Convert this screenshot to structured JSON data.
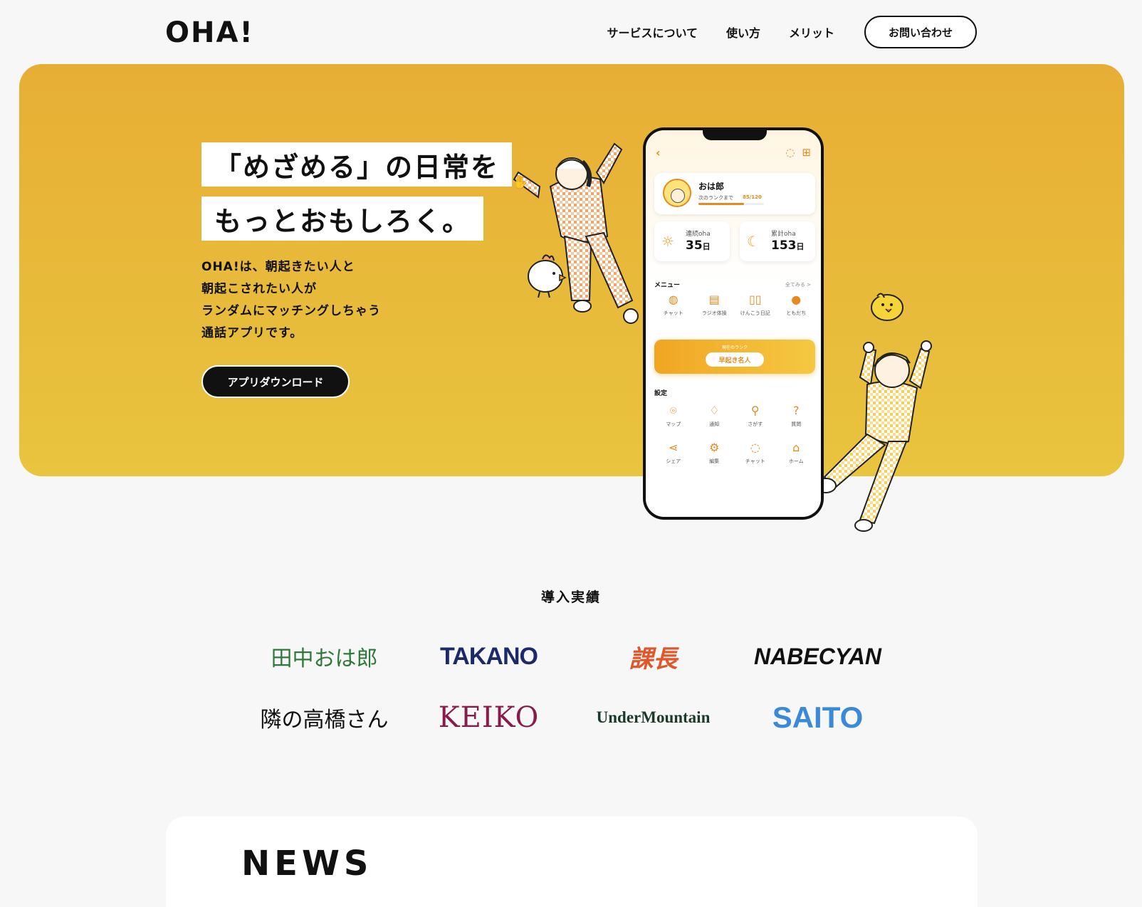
{
  "header": {
    "logo_text": "OHA!",
    "nav": [
      "サービスについて",
      "使い方",
      "メリット"
    ],
    "contact_label": "お問い合わせ"
  },
  "hero": {
    "headline_1": "「めざめる」の日常を",
    "headline_2": "もっとおもしろく。",
    "description": [
      "OHA!は、朝起きたい人と",
      "朝起こされたい人が",
      "ランダムにマッチングしちゃう",
      "通話アプリです。"
    ],
    "download_label": "アプリダウンロード"
  },
  "phone": {
    "back_icon": "chevron-left-icon",
    "profile": {
      "name": "おは郎",
      "rank_text": "次のランクまで",
      "rank_value": "85/120",
      "progress": 0.7
    },
    "stats": [
      {
        "icon": "sunrise-icon",
        "label": "連続oha",
        "value": "35",
        "unit": "日"
      },
      {
        "icon": "moon-icon",
        "label": "累計oha",
        "value": "153",
        "unit": "日"
      }
    ],
    "menu_title": "メニュー",
    "menu_see_all": "全てみる >",
    "menu_items": [
      {
        "icon": "chat-icon",
        "label": "チャット"
      },
      {
        "icon": "radio-icon",
        "label": "ラジオ体操"
      },
      {
        "icon": "book-icon",
        "label": "けんこう日記"
      },
      {
        "icon": "person-icon",
        "label": "ともだち"
      }
    ],
    "rank_caption": "現在のランク",
    "rank_name": "早起き名人",
    "settings_title": "設定",
    "settings_items": [
      {
        "icon": "map-pin-icon",
        "label": "マップ"
      },
      {
        "icon": "bell-icon",
        "label": "通知"
      },
      {
        "icon": "search-icon",
        "label": "さがす"
      },
      {
        "icon": "question-icon",
        "label": "質問"
      },
      {
        "icon": "share-icon",
        "label": "シェア"
      },
      {
        "icon": "gear-icon",
        "label": "編集"
      },
      {
        "icon": "chat-icon",
        "label": "チャット"
      },
      {
        "icon": "home-icon",
        "label": "ホーム"
      }
    ]
  },
  "achievements": {
    "title": "導入実績",
    "logos": [
      {
        "text": "田中おは郎",
        "color": "#2f7a3a"
      },
      {
        "text": "TAKANO",
        "color": "#1c2a6b"
      },
      {
        "text": "課長",
        "color": "#e0572a"
      },
      {
        "text": "NABECYAN",
        "color": "#111111"
      },
      {
        "text": "隣の高橋さん",
        "color": "#111111"
      },
      {
        "text": "KEIKO",
        "color": "#8a1a4a"
      },
      {
        "text": "UnderMountain",
        "color": "#1a3a2a"
      },
      {
        "text": "SAITO",
        "color": "#3a8ad8"
      }
    ]
  },
  "news": {
    "title": "NEWS"
  },
  "colors": {
    "accent": "#e9b53a",
    "orange": "#e58a1f"
  }
}
